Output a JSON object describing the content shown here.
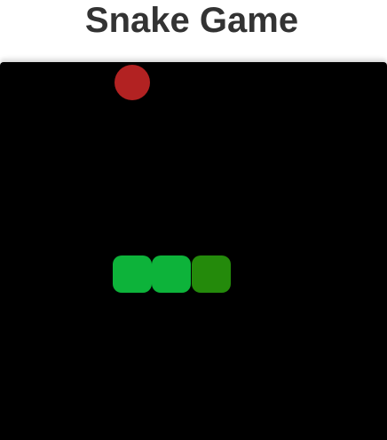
{
  "header": {
    "title": "Snake Game"
  },
  "game": {
    "board_color": "#000000",
    "food": {
      "color": "#b22222"
    },
    "snake": {
      "body_color": "#0db33a",
      "head_color": "#248a0b",
      "length": 3,
      "direction": "right"
    }
  }
}
